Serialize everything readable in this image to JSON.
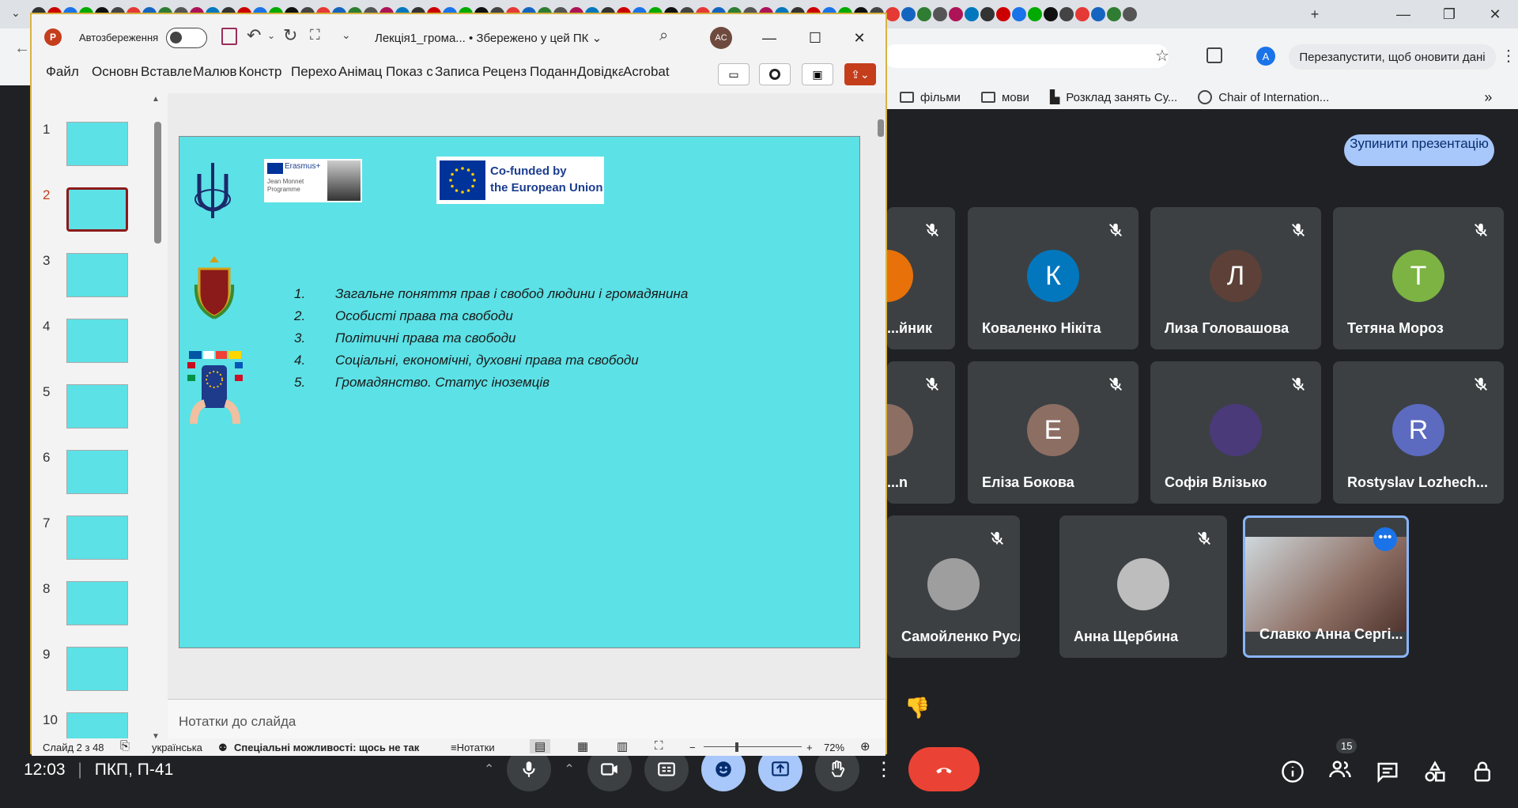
{
  "browser": {
    "restart_label": "Перезапустити, щоб оновити дані",
    "profile_initial": "A",
    "bookmarks": [
      {
        "label": "фільми",
        "icon": "folder-icon"
      },
      {
        "label": "мови",
        "icon": "folder-icon"
      },
      {
        "label": "Розклад занять Су...",
        "icon": "bookmark-icon"
      },
      {
        "label": "Chair of Internation...",
        "icon": "globe-icon"
      }
    ]
  },
  "powerpoint": {
    "autosave_label": "Автозбереження",
    "doc_title": "Лекція1_грома...  • Збережено у цей ПК",
    "user_initials": "AC",
    "ribbon_tabs": [
      "Файл",
      "Основн",
      "Вставле",
      "Малюв",
      "Констр",
      "Перехо",
      "Анімац",
      "Показ с",
      "Записа",
      "Реценз",
      "Подання",
      "Довідка",
      "Acrobat"
    ],
    "thumbnails": [
      "1",
      "2",
      "3",
      "4",
      "5",
      "6",
      "7",
      "8",
      "9",
      "10"
    ],
    "selected_slide": "2",
    "slide": {
      "erasmus_text": "Erasmus+",
      "jean_monnet": "Jean Monnet Programme",
      "cofunded_line1": "Co-funded by",
      "cofunded_line2": "the European Union",
      "items": [
        {
          "n": "1.",
          "text": "Загальне поняття прав і свобод людини і громадянина"
        },
        {
          "n": "2.",
          "text": "Особисті права та свободи"
        },
        {
          "n": "3.",
          "text": "Політичні права та свободи"
        },
        {
          "n": "4.",
          "text": "Соціальні, економічні, духовні права та свободи"
        },
        {
          "n": "5.",
          "text": "Громадянство. Статус іноземців"
        }
      ]
    },
    "notes_placeholder": "Нотатки до слайда",
    "status": {
      "slide_counter": "Слайд 2 з 48",
      "language": "українська",
      "accessibility": "Спеціальні можливості: щось не так",
      "notes_label": "Нотатки",
      "zoom": "72%"
    }
  },
  "meet": {
    "stop_presenting": "Зупинити презентацію",
    "time": "12:03",
    "meeting_name": "ПКП, П-41",
    "participant_count": "15",
    "participants": [
      {
        "name": "...йник",
        "initial": "",
        "color": "#e8710a"
      },
      {
        "name": "Коваленко Нікіта",
        "initial": "К",
        "color": "#0277bd"
      },
      {
        "name": "Лиза Головашова",
        "initial": "Л",
        "color": "#5d4037"
      },
      {
        "name": "Тетяна Мороз",
        "initial": "Т",
        "color": "#7cb342"
      },
      {
        "name": "...n",
        "initial": "",
        "color": "#8d6e63"
      },
      {
        "name": "Еліза Бокова",
        "initial": "Е",
        "color": "#8d6e63"
      },
      {
        "name": "Софія Влізько",
        "initial": "",
        "color": "#4a3a7a"
      },
      {
        "name": "Rostyslav Lozhech...",
        "initial": "R",
        "color": "#5c6bc0"
      },
      {
        "name": "Самойленко Руслан",
        "initial": "",
        "color": "#9e9e9e"
      },
      {
        "name": "Анна Щербина",
        "initial": "",
        "color": "#bdbdbd"
      },
      {
        "name": "Славко Анна Сергі...",
        "initial": "",
        "color": "#a5846a"
      }
    ]
  }
}
